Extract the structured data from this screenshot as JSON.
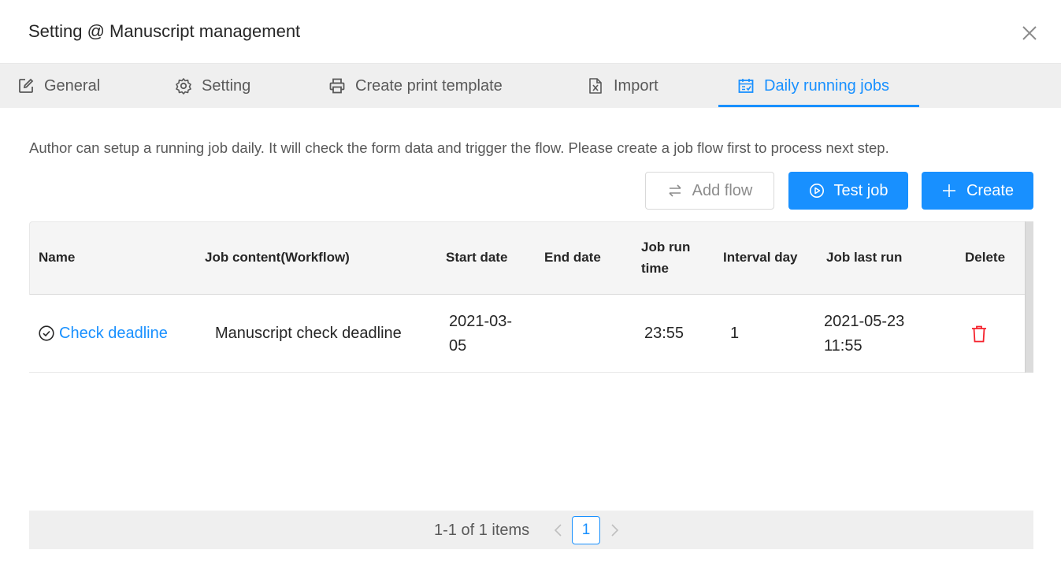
{
  "dialog": {
    "title": "Setting @ Manuscript management",
    "close_icon": "close-icon"
  },
  "tabs": [
    {
      "label": "General",
      "icon": "edit-icon",
      "active": false
    },
    {
      "label": "Setting",
      "icon": "gear-icon",
      "active": false
    },
    {
      "label": "Create print template",
      "icon": "printer-icon",
      "active": false
    },
    {
      "label": "Import",
      "icon": "excel-file-icon",
      "active": false
    },
    {
      "label": "Daily running jobs",
      "icon": "calendar-icon",
      "active": true
    }
  ],
  "description": "Author can setup a running job daily. It will check the form data and trigger the flow. Please create a job flow first to process next step.",
  "toolbar": {
    "add_flow_label": "Add flow",
    "test_job_label": "Test job",
    "create_label": "Create"
  },
  "table": {
    "columns": {
      "name": "Name",
      "job_content": "Job content(Workflow)",
      "start_date": "Start date",
      "end_date": "End date",
      "job_run_time_1": "Job run",
      "job_run_time_2": "time",
      "interval_day": "Interval day",
      "job_last_run": "Job last run",
      "delete": "Delete"
    },
    "rows": [
      {
        "name": "Check deadline",
        "job_content": "Manuscript check deadline",
        "start_date_1": "2021-03-",
        "start_date_2": "05",
        "end_date": "",
        "job_run_time": "23:55",
        "interval_day": "1",
        "job_last_run_1": "2021-05-23",
        "job_last_run_2": "11:55"
      }
    ]
  },
  "pagination": {
    "total_text": "1-1 of 1 items",
    "current_page": "1"
  },
  "colors": {
    "accent": "#1890ff",
    "danger": "#f5222d"
  }
}
